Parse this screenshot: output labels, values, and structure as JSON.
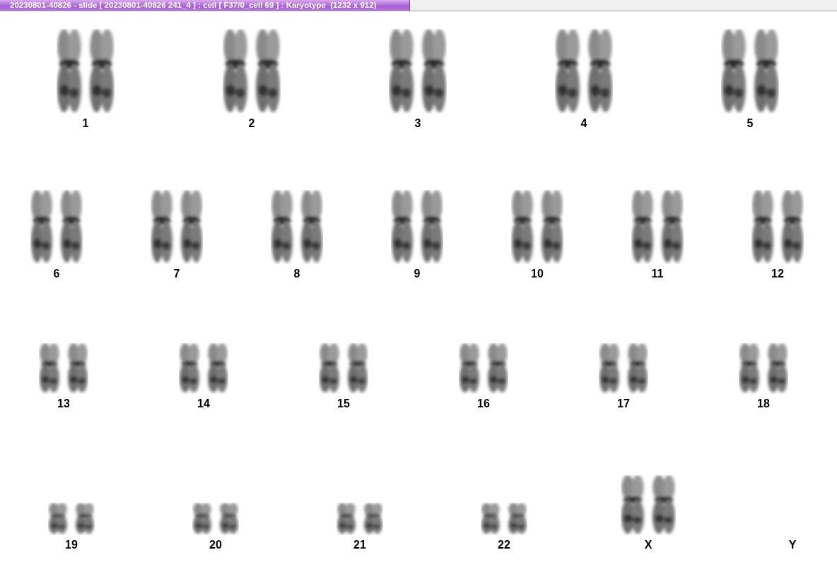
{
  "window": {
    "title": "20230801-40826 - slide [ 20230801-40826 241_4 ] : cell [ F37/0_cell 69 ] : Karyotype  (1232 x 912)"
  },
  "karyotype": {
    "rows": [
      {
        "pairs": [
          {
            "label": "1",
            "kind": "pair"
          },
          {
            "label": "2",
            "kind": "pair"
          },
          {
            "label": "3",
            "kind": "pair"
          },
          {
            "label": "4",
            "kind": "pair"
          },
          {
            "label": "5",
            "kind": "pair"
          }
        ]
      },
      {
        "pairs": [
          {
            "label": "6",
            "kind": "pair"
          },
          {
            "label": "7",
            "kind": "pair"
          },
          {
            "label": "8",
            "kind": "pair"
          },
          {
            "label": "9",
            "kind": "pair"
          },
          {
            "label": "10",
            "kind": "pair"
          },
          {
            "label": "11",
            "kind": "pair"
          },
          {
            "label": "12",
            "kind": "pair"
          }
        ]
      },
      {
        "pairs": [
          {
            "label": "13",
            "kind": "pair"
          },
          {
            "label": "14",
            "kind": "pair"
          },
          {
            "label": "15",
            "kind": "pair"
          },
          {
            "label": "16",
            "kind": "pair"
          },
          {
            "label": "17",
            "kind": "pair"
          },
          {
            "label": "18",
            "kind": "pair"
          }
        ]
      },
      {
        "pairs": [
          {
            "label": "19",
            "kind": "pair"
          },
          {
            "label": "20",
            "kind": "pair"
          },
          {
            "label": "21",
            "kind": "pair"
          },
          {
            "label": "22",
            "kind": "pair"
          },
          {
            "label": "X",
            "kind": "pair"
          },
          {
            "label": "Y",
            "kind": "empty"
          }
        ]
      }
    ]
  }
}
